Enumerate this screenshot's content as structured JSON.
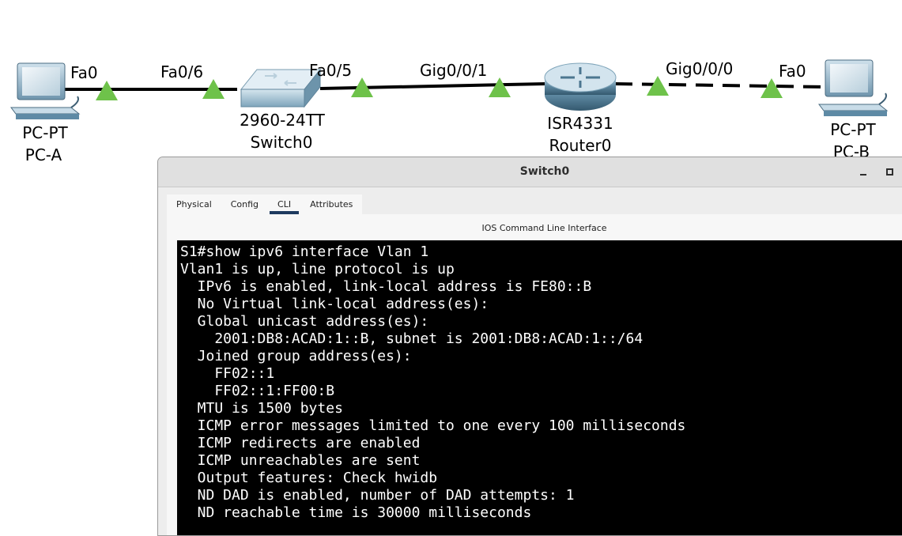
{
  "topology": {
    "devices": [
      {
        "model": "PC-PT",
        "name": "PC-A",
        "icon": "pc-icon"
      },
      {
        "model": "2960-24TT",
        "name": "Switch0",
        "icon": "switch-icon"
      },
      {
        "model": "ISR4331",
        "name": "Router0",
        "icon": "router-icon"
      },
      {
        "model": "PC-PT",
        "name": "PC-B",
        "icon": "pc-icon"
      }
    ],
    "ports": {
      "pca_fa0": "Fa0",
      "sw_fa06": "Fa0/6",
      "sw_fa05": "Fa0/5",
      "r_gig001": "Gig0/0/1",
      "r_gig000": "Gig0/0/0",
      "pcb_fa0": "Fa0"
    },
    "link_status_color": "#6ec24a"
  },
  "window": {
    "title": "Switch0",
    "tabs": [
      {
        "label": "Physical",
        "active": false
      },
      {
        "label": "Config",
        "active": false
      },
      {
        "label": "CLI",
        "active": true
      },
      {
        "label": "Attributes",
        "active": false
      }
    ],
    "panel_caption": "IOS Command Line Interface",
    "terminal_lines": [
      "S1#show ipv6 interface Vlan 1",
      "Vlan1 is up, line protocol is up",
      "  IPv6 is enabled, link-local address is FE80::B",
      "  No Virtual link-local address(es):",
      "  Global unicast address(es):",
      "    2001:DB8:ACAD:1::B, subnet is 2001:DB8:ACAD:1::/64",
      "  Joined group address(es):",
      "    FF02::1",
      "    FF02::1:FF00:B",
      "  MTU is 1500 bytes",
      "  ICMP error messages limited to one every 100 milliseconds",
      "  ICMP redirects are enabled",
      "  ICMP unreachables are sent",
      "  Output features: Check hwidb",
      "  ND DAD is enabled, number of DAD attempts: 1",
      "  ND reachable time is 30000 milliseconds"
    ]
  }
}
